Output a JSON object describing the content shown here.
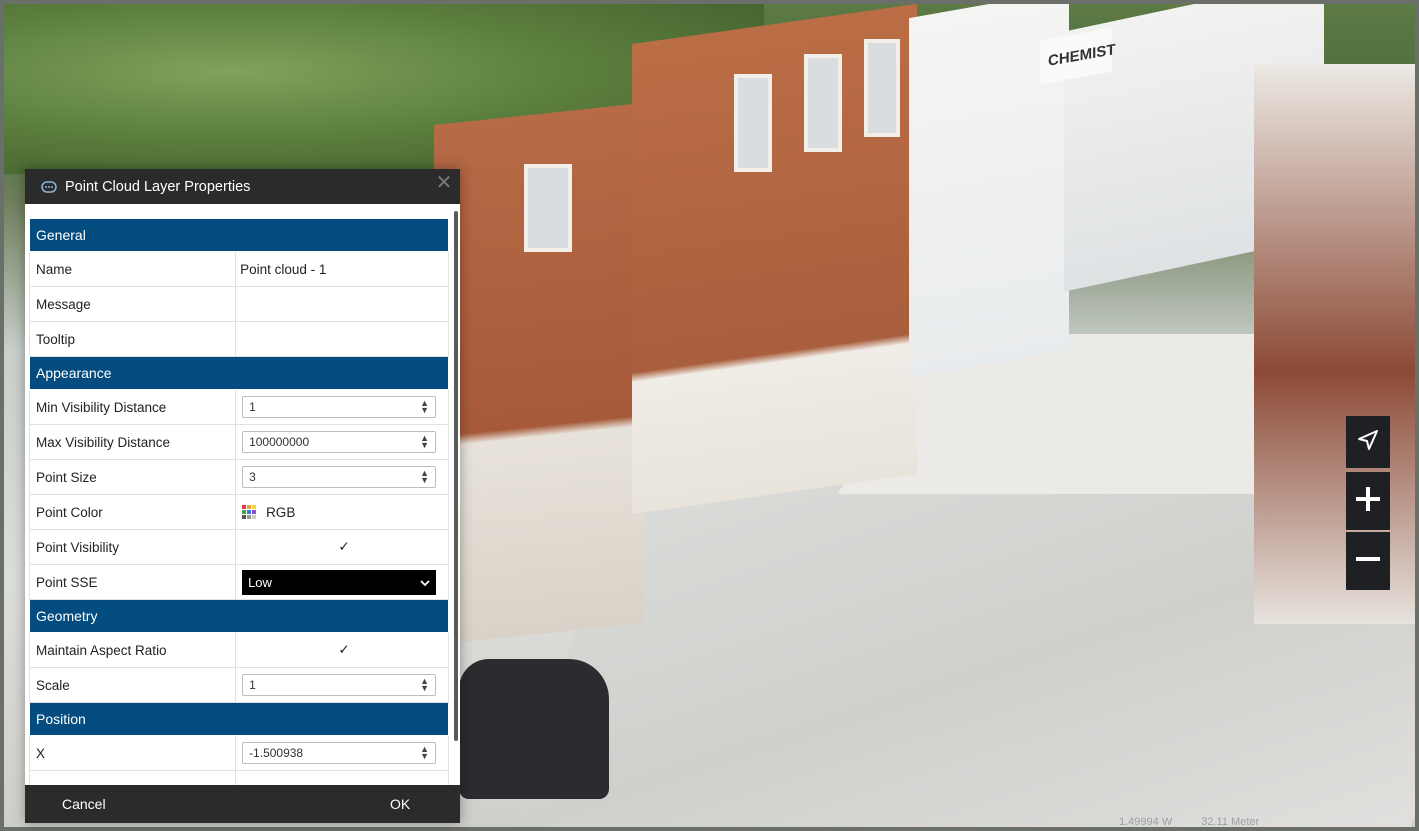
{
  "viewer": {
    "building_sign": "CHEMIST",
    "scale_readouts": [
      "1.49994 W",
      "32.11 Meter"
    ]
  },
  "map_controls": {
    "locate_icon": "navigation-arrow-icon",
    "zoom_in_label": "+",
    "zoom_out_label": "−"
  },
  "dialog": {
    "title": "Point Cloud Layer Properties",
    "title_icon": "point-cloud-icon",
    "close_label": "✕",
    "sections": {
      "general": "General",
      "appearance": "Appearance",
      "geometry": "Geometry",
      "position": "Position"
    },
    "fields": {
      "name": {
        "label": "Name",
        "value": "Point cloud - 1"
      },
      "message": {
        "label": "Message",
        "value": ""
      },
      "tooltip": {
        "label": "Tooltip",
        "value": ""
      },
      "min_vis": {
        "label": "Min Visibility Distance",
        "value": "1"
      },
      "max_vis": {
        "label": "Max Visibility Distance",
        "value": "100000000"
      },
      "point_size": {
        "label": "Point Size",
        "value": "3"
      },
      "point_color": {
        "label": "Point Color",
        "value": "RGB"
      },
      "point_visibility": {
        "label": "Point Visibility",
        "checked": true
      },
      "point_sse": {
        "label": "Point SSE",
        "value": "Low"
      },
      "aspect": {
        "label": "Maintain Aspect Ratio",
        "checked": true
      },
      "scale": {
        "label": "Scale",
        "value": "1"
      },
      "x": {
        "label": "X",
        "value": "-1.500938"
      }
    },
    "buttons": {
      "cancel": "Cancel",
      "ok": "OK"
    }
  },
  "colors": {
    "section_header": "#024c7f",
    "title_bar": "#2b2b2b",
    "control_bg": "#1f2024"
  }
}
